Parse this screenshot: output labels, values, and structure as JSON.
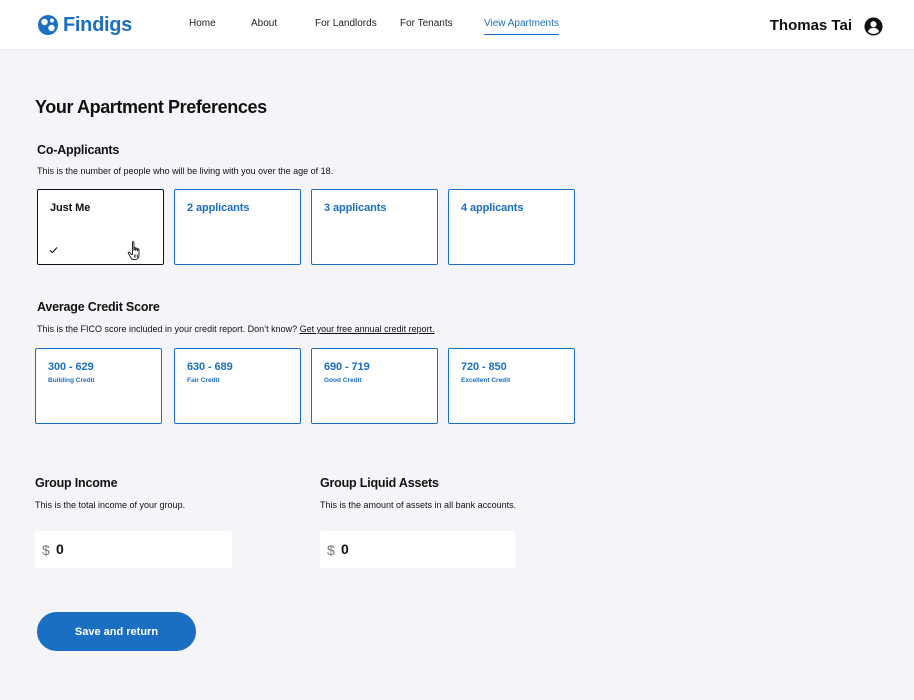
{
  "brand": {
    "name": "Findigs",
    "color": "#1a6fc2"
  },
  "nav": {
    "items": [
      {
        "label": "Home",
        "active": false
      },
      {
        "label": "About",
        "active": false
      },
      {
        "label": "For Landlords",
        "active": false
      },
      {
        "label": "For Tenants",
        "active": false
      },
      {
        "label": "View Apartments",
        "active": true
      }
    ]
  },
  "user": {
    "name": "Thomas Tai",
    "icon": "account-circle-icon"
  },
  "page": {
    "title": "Your Apartment Preferences"
  },
  "co_applicants": {
    "title": "Co-Applicants",
    "description": "This is the number of people who will be living with you over the age of 18.",
    "options": [
      {
        "label": "Just Me",
        "selected": true
      },
      {
        "label": "2 applicants",
        "selected": false
      },
      {
        "label": "3 applicants",
        "selected": false
      },
      {
        "label": "4 applicants",
        "selected": false
      }
    ]
  },
  "credit_score": {
    "title": "Average Credit Score",
    "description": "This is the FICO score included in your credit report.  Don’t know? ",
    "link_text": "Get your free annual credit report.",
    "options": [
      {
        "range": "300 -  629",
        "tier": "Building Credit"
      },
      {
        "range": "630 - 689",
        "tier": "Fair Credit"
      },
      {
        "range": "690 - 719",
        "tier": "Good Credit"
      },
      {
        "range": "720 - 850",
        "tier": "Excellent Credit"
      }
    ]
  },
  "group_income": {
    "title": "Group Income",
    "description": "This is the total income of your group.",
    "currency": "$",
    "value": "0"
  },
  "group_assets": {
    "title": "Group Liquid Assets",
    "description": "This is the amount of assets in all bank accounts.",
    "currency": "$",
    "value": "0"
  },
  "actions": {
    "save_label": "Save and return"
  }
}
